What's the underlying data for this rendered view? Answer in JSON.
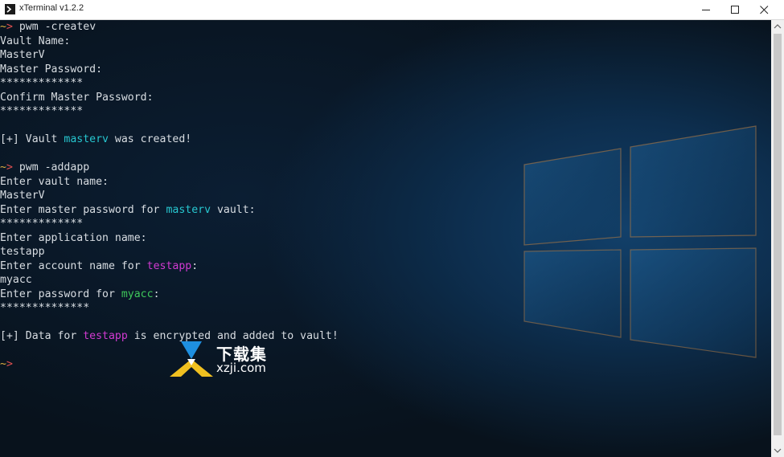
{
  "window": {
    "title": "xTerminal v1.2.2"
  },
  "terminal": {
    "prompt_symbol": "~",
    "prompt_arrow": ">",
    "lines": [
      {
        "cmd": "pwm -createv"
      },
      {
        "text": "Vault Name:"
      },
      {
        "text": "MasterV"
      },
      {
        "text": "Master Password:"
      },
      {
        "text": "*************"
      },
      {
        "text": "Confirm Master Password:"
      },
      {
        "text": "*************"
      },
      {
        "text": ""
      },
      {
        "pre": "[+] Vault ",
        "hl": "masterv",
        "post": " was created!"
      },
      {
        "text": ""
      },
      {
        "cmd": "pwm -addapp"
      },
      {
        "text": "Enter vault name:"
      },
      {
        "text": "MasterV"
      },
      {
        "pre": "Enter master password for ",
        "hl": "masterv",
        "post": " vault:"
      },
      {
        "text": "*************"
      },
      {
        "text": "Enter application name:"
      },
      {
        "text": "testapp"
      },
      {
        "pre": "Enter account name for ",
        "hl": "testapp",
        "post": ":"
      },
      {
        "text": "myacc"
      },
      {
        "pre": "Enter password for ",
        "hl": "myacc",
        "post": ":"
      },
      {
        "text": "**************"
      },
      {
        "text": ""
      },
      {
        "pre": "[+] Data for ",
        "hl": "testapp",
        "post": " is encrypted and added to vault!"
      },
      {
        "text": ""
      },
      {
        "cmd": ""
      }
    ]
  },
  "watermark": {
    "cn": "下载集",
    "en": "xzji.com"
  },
  "colors": {
    "vault_highlight": "#27c7d0",
    "app_highlight": "#d23ad2",
    "account_highlight": "#3fc85a",
    "prompt_tilde": "#e0b040",
    "prompt_arrow": "#e05050"
  },
  "icons": [
    "terminal-app-icon",
    "minimize-icon",
    "maximize-icon",
    "close-icon",
    "scroll-up-icon",
    "scroll-down-icon",
    "windows-logo",
    "download-logo"
  ]
}
